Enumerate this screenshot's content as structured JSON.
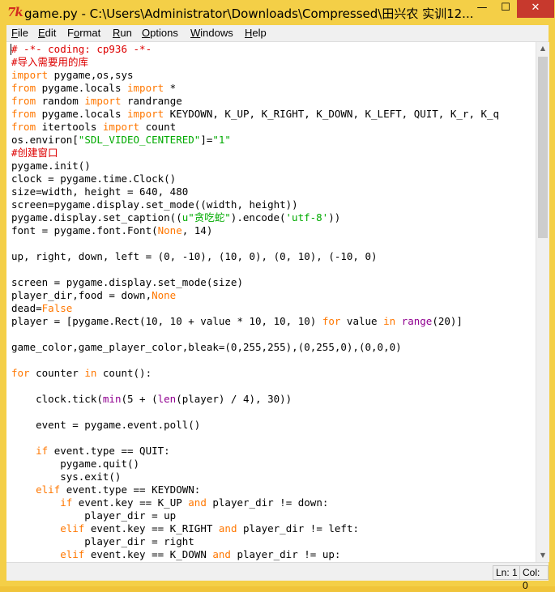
{
  "window": {
    "title": "game.py - C:\\Users\\Administrator\\Downloads\\Compressed\\田兴农 实训12...",
    "app_icon_text": "7k",
    "minimize": "—",
    "maximize": "☐",
    "close": "✕"
  },
  "menu": [
    "File",
    "Edit",
    "Format",
    "Run",
    "Options",
    "Windows",
    "Help"
  ],
  "menu_underline": [
    "F",
    "E",
    "o",
    "R",
    "O",
    "W",
    "H"
  ],
  "colors": {
    "comment": "#dd0000",
    "keyword": "#ff7700",
    "string": "#00aa00",
    "builtin": "#900090",
    "title_bar": "#f4cf47",
    "close_button": "#c7392d"
  },
  "code_lines": [
    [
      [
        "cm",
        "# -*- coding: cp936 -*-"
      ]
    ],
    [
      [
        "cm",
        "#导入需要用的库"
      ]
    ],
    [
      [
        "kw",
        "import"
      ],
      [
        "",
        " pygame,os,sys"
      ]
    ],
    [
      [
        "kw",
        "from"
      ],
      [
        "",
        " pygame.locals "
      ],
      [
        "kw",
        "import"
      ],
      [
        "",
        " *"
      ]
    ],
    [
      [
        "kw",
        "from"
      ],
      [
        "",
        " random "
      ],
      [
        "kw",
        "import"
      ],
      [
        "",
        " randrange"
      ]
    ],
    [
      [
        "kw",
        "from"
      ],
      [
        "",
        " pygame.locals "
      ],
      [
        "kw",
        "import"
      ],
      [
        "",
        " KEYDOWN, K_UP, K_RIGHT, K_DOWN, K_LEFT, QUIT, K_r, K_q"
      ]
    ],
    [
      [
        "kw",
        "from"
      ],
      [
        "",
        " itertools "
      ],
      [
        "kw",
        "import"
      ],
      [
        "",
        " count"
      ]
    ],
    [
      [
        "",
        "os.environ["
      ],
      [
        "st",
        "\"SDL_VIDEO_CENTERED\""
      ],
      [
        "",
        "]="
      ],
      [
        "st",
        "\"1\""
      ]
    ],
    [
      [
        "cm",
        "#创建窗口"
      ]
    ],
    [
      [
        "",
        "pygame.init()"
      ]
    ],
    [
      [
        "",
        "clock = pygame.time.Clock()"
      ]
    ],
    [
      [
        "",
        "size=width, height = 640, 480"
      ]
    ],
    [
      [
        "",
        "screen=pygame.display.set_mode((width, height))"
      ]
    ],
    [
      [
        "",
        "pygame.display.set_caption(("
      ],
      [
        "st",
        "u\"贪吃蛇\""
      ],
      [
        "",
        ").encode("
      ],
      [
        "st",
        "'utf-8'"
      ],
      [
        "",
        "))"
      ]
    ],
    [
      [
        "",
        "font = pygame.font.Font("
      ],
      [
        "kw",
        "None"
      ],
      [
        "",
        ", 14)"
      ]
    ],
    [
      [
        "",
        ""
      ]
    ],
    [
      [
        "",
        "up, right, down, left = (0, -10), (10, 0), (0, 10), (-10, 0)"
      ]
    ],
    [
      [
        "",
        ""
      ]
    ],
    [
      [
        "",
        "screen = pygame.display.set_mode(size)"
      ]
    ],
    [
      [
        "",
        "player_dir,food = down,"
      ],
      [
        "kw",
        "None"
      ]
    ],
    [
      [
        "",
        "dead="
      ],
      [
        "kw",
        "False"
      ]
    ],
    [
      [
        "",
        "player = [pygame.Rect(10, 10 + value * 10, 10, 10) "
      ],
      [
        "kw",
        "for"
      ],
      [
        "",
        " value "
      ],
      [
        "kw",
        "in"
      ],
      [
        "",
        " "
      ],
      [
        "bi",
        "range"
      ],
      [
        "",
        "(20)]"
      ]
    ],
    [
      [
        "",
        ""
      ]
    ],
    [
      [
        "",
        "game_color,game_player_color,bleak=(0,255,255),(0,255,0),(0,0,0)"
      ]
    ],
    [
      [
        "",
        ""
      ]
    ],
    [
      [
        "kw",
        "for"
      ],
      [
        "",
        " counter "
      ],
      [
        "kw",
        "in"
      ],
      [
        "",
        " count():"
      ]
    ],
    [
      [
        "",
        ""
      ]
    ],
    [
      [
        "",
        "    clock.tick("
      ],
      [
        "bi",
        "min"
      ],
      [
        "",
        "(5 + ("
      ],
      [
        "bi",
        "len"
      ],
      [
        "",
        "(player) / 4), 30))"
      ]
    ],
    [
      [
        "",
        ""
      ]
    ],
    [
      [
        "",
        "    event = pygame.event.poll()"
      ]
    ],
    [
      [
        "",
        ""
      ]
    ],
    [
      [
        "",
        "    "
      ],
      [
        "kw",
        "if"
      ],
      [
        "",
        " event.type == QUIT:"
      ]
    ],
    [
      [
        "",
        "        pygame.quit()"
      ]
    ],
    [
      [
        "",
        "        sys.exit()"
      ]
    ],
    [
      [
        "",
        "    "
      ],
      [
        "kw",
        "elif"
      ],
      [
        "",
        " event.type == KEYDOWN:"
      ]
    ],
    [
      [
        "",
        "        "
      ],
      [
        "kw",
        "if"
      ],
      [
        "",
        " event.key == K_UP "
      ],
      [
        "kw",
        "and"
      ],
      [
        "",
        " player_dir != down:"
      ]
    ],
    [
      [
        "",
        "            player_dir = up"
      ]
    ],
    [
      [
        "",
        "        "
      ],
      [
        "kw",
        "elif"
      ],
      [
        "",
        " event.key == K_RIGHT "
      ],
      [
        "kw",
        "and"
      ],
      [
        "",
        " player_dir != left:"
      ]
    ],
    [
      [
        "",
        "            player_dir = right"
      ]
    ],
    [
      [
        "",
        "        "
      ],
      [
        "kw",
        "elif"
      ],
      [
        "",
        " event.key == K_DOWN "
      ],
      [
        "kw",
        "and"
      ],
      [
        "",
        " player_dir != up:"
      ]
    ]
  ],
  "status": {
    "line": "Ln: 1",
    "col": "Col: 0"
  },
  "scrollbar": {
    "position_fraction": 0.0,
    "visible_fraction": 0.37
  }
}
